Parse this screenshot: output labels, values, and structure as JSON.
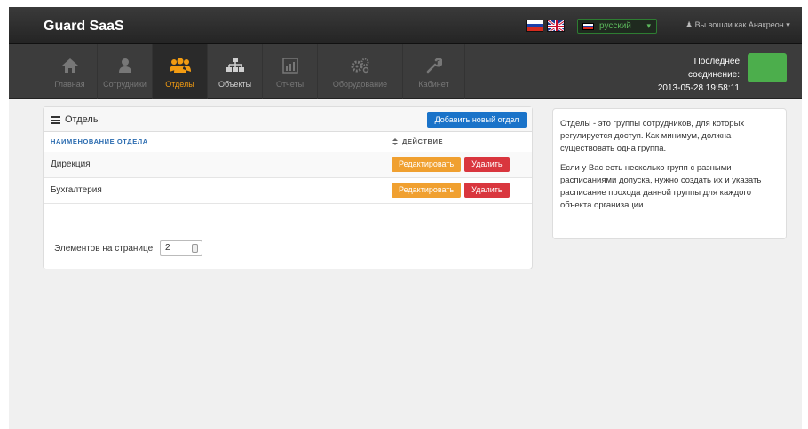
{
  "app": {
    "brand": "Guard SaaS"
  },
  "header": {
    "language": "русский",
    "user": "Вы вошли как Анакреон"
  },
  "nav": {
    "items": [
      {
        "label": "Главная",
        "icon": "home-icon"
      },
      {
        "label": "Сотрудники",
        "icon": "user-icon"
      },
      {
        "label": "Отделы",
        "icon": "group-icon",
        "active": true
      },
      {
        "label": "Объекты",
        "icon": "sitemap-icon"
      },
      {
        "label": "Отчеты",
        "icon": "chart-icon"
      },
      {
        "label": "Оборудование",
        "icon": "gears-icon"
      },
      {
        "label": "Кабинет",
        "icon": "wrench-icon"
      }
    ],
    "last_connection_label": "Последнее соединение:",
    "last_connection_time": "2013-05-28 19:58:11",
    "status_color": "#4cae4c"
  },
  "panel": {
    "title": "Отделы",
    "add_button": "Добавить новый отдел",
    "columns": {
      "name": "НАИМЕНОВАНИЕ ОТДЕЛА",
      "action": "ДЕЙСТВИЕ"
    },
    "rows": [
      {
        "name": "Дирекция",
        "edit": "Редактировать",
        "delete": "Удалить"
      },
      {
        "name": "Бухгалтерия",
        "edit": "Редактировать",
        "delete": "Удалить"
      }
    ],
    "per_page_label": "Элементов на странице:",
    "per_page_value": "2"
  },
  "info": {
    "p1": "Отделы - это группы сотрудников, для которых регулируется доступ. Как минимум, должна существовать одна группа.",
    "p2": "Если у Вас есть несколько групп с разными расписаниями допуска, нужно создать их и указать расписание прохода данной группы для каждого объекта организации."
  },
  "colors": {
    "accent": "#f39c12",
    "primary": "#1a73c9",
    "danger": "#d9363e",
    "warning": "#f0a030"
  }
}
